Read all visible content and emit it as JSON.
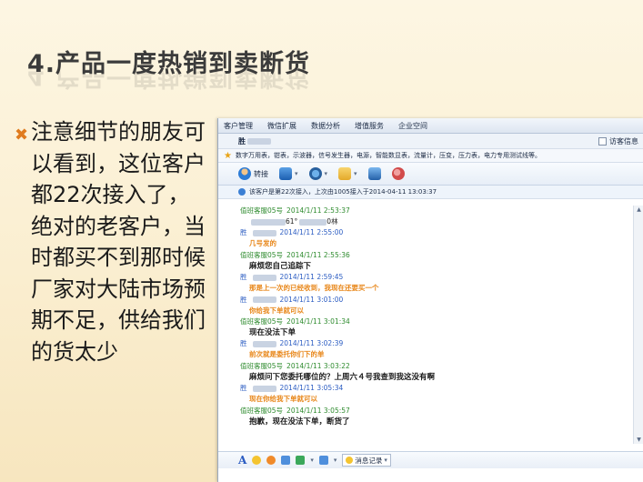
{
  "slide": {
    "title": "4.产品一度热销到卖断货",
    "bullet_text": "注意细节的朋友可以看到，这位客户都22次接入了，绝对的老客户，当时都买不到那时候厂家对大陆市场预期不足，供给我们的货太少",
    "bullet_mark": "✖"
  },
  "chat_window": {
    "menu": [
      "客户管理",
      "微信扩展",
      "数据分析",
      "增值服务",
      "企业空间"
    ],
    "visitor_label": "访客信息",
    "customer_name_prefix": "胜",
    "tags_text": "数字万用表，钳表，示波器，信号发生器，电源，智能数显表，流量计，压变，压力表，电力专用测试线等。",
    "toolbar": {
      "transfer_label": "转接"
    },
    "info_text": "该客户是第22次接入，上次由1005接入于2014-04-11 13:03:37",
    "messages": [
      {
        "kind": "agent",
        "who": "值班客服05号",
        "time": "2014/1/11 2:53:37",
        "text": "61°",
        "text_suffix": "0林",
        "style": "agent"
      },
      {
        "kind": "cust",
        "who": "胜",
        "time": "2014/1/11 2:55:00",
        "text": "几号发的",
        "style": "cust"
      },
      {
        "kind": "agent",
        "who": "值班客服05号",
        "time": "2014/1/11 2:55:36",
        "text": "麻烦您自己追踪下",
        "style": "agent"
      },
      {
        "kind": "cust",
        "who": "胜",
        "time": "2014/1/11 2:59:45",
        "text": "那是上一次的已经收到，我现在还要买一个",
        "style": "cust"
      },
      {
        "kind": "cust",
        "who": "胜",
        "time": "2014/1/11 3:01:00",
        "text": "你给我下单就可以",
        "style": "cust"
      },
      {
        "kind": "agent",
        "who": "值班客服05号",
        "time": "2014/1/11 3:01:34",
        "text": "现在没法下单",
        "style": "agent"
      },
      {
        "kind": "cust",
        "who": "胜",
        "time": "2014/1/11 3:02:39",
        "text": "前次就是委托你们下的单",
        "style": "cust"
      },
      {
        "kind": "agent",
        "who": "值班客服05号",
        "time": "2014/1/11 3:03:22",
        "text": "麻烦问下您委托哪位的？上周六４号我查到我这没有啊",
        "style": "agent"
      },
      {
        "kind": "cust",
        "who": "胜",
        "time": "2014/1/11 3:05:34",
        "text": "现在你给我下单就可以",
        "style": "cust"
      },
      {
        "kind": "agent",
        "who": "值班客服05号",
        "time": "2014/1/11 3:05:57",
        "text": "抱歉，现在没法下单，断货了",
        "style": "agent"
      }
    ],
    "input_toolbar": {
      "font_label": "A",
      "history_label": "消息记录"
    }
  },
  "colors": {
    "agent_name": "#2e8b2e",
    "customer_name": "#2b5cc2",
    "customer_msg": "#e8871a",
    "bullet": "#e07b1e"
  }
}
